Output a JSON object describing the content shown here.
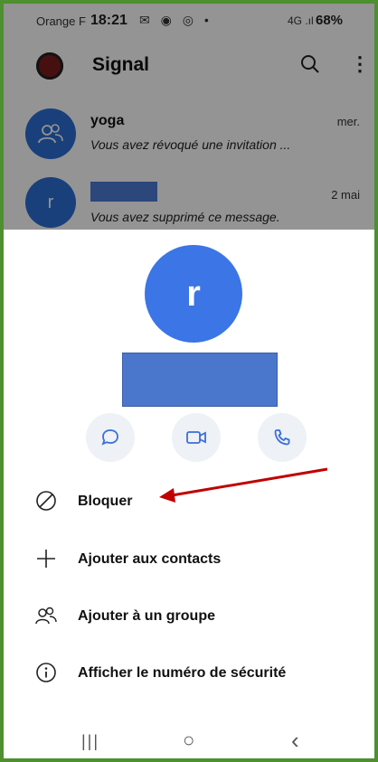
{
  "status_bar": {
    "carrier": "Orange F",
    "time": "18:21",
    "notif_icons": "✉ ◉ ◎ •",
    "signal": "4G .ıl",
    "battery": "68%"
  },
  "app_bar": {
    "title": "Signal"
  },
  "conversations": [
    {
      "name": "yoga",
      "date": "mer.",
      "message": "Vous avez révoqué une invitation ...",
      "avatar_icon": "group-icon"
    },
    {
      "name": "",
      "date": "2 mai",
      "message": "Vous avez supprimé ce message.",
      "avatar_letter": "r"
    }
  ],
  "sheet": {
    "avatar_letter": "r",
    "actions": [
      "chat-icon",
      "video-icon",
      "phone-icon"
    ],
    "menu": [
      {
        "label": "Bloquer",
        "icon": "block-icon"
      },
      {
        "label": "Ajouter aux contacts",
        "icon": "plus-icon"
      },
      {
        "label": "Ajouter à un groupe",
        "icon": "group-icon"
      },
      {
        "label": "Afficher le numéro de sécurité",
        "icon": "info-icon"
      }
    ]
  },
  "nav_bar": {
    "recent": "|||",
    "home": "○",
    "back": "‹"
  },
  "colors": {
    "frame": "#4e8f2f",
    "avatar": "#3b75e6",
    "redaction": "#4a76cc",
    "annotation_arrow": "#c00000"
  }
}
